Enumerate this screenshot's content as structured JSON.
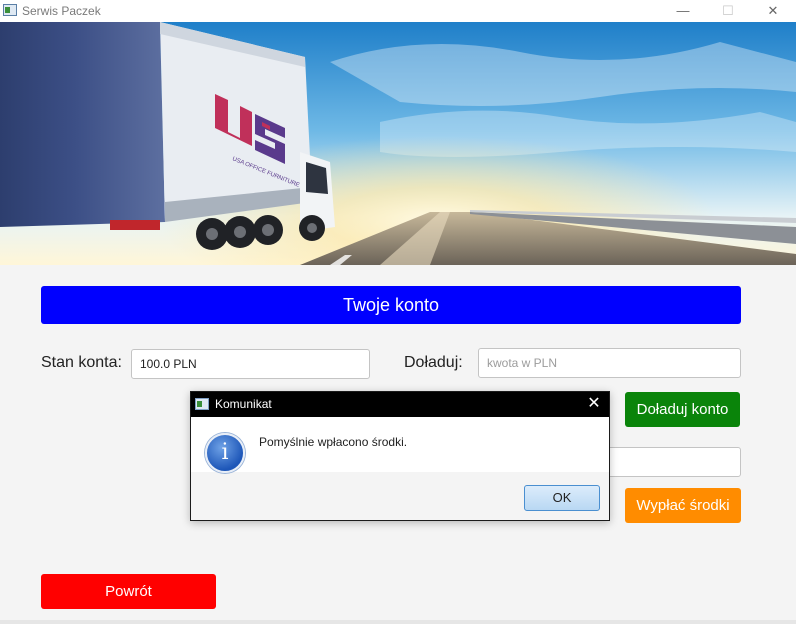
{
  "window": {
    "title": "Serwis Paczek",
    "minimize": "—",
    "maximize": "☐",
    "close": "✕"
  },
  "banner": {
    "logo_text": "USA",
    "logo_subtitle": "USA OFFICE FURNITURE"
  },
  "account": {
    "header": "Twoje konto",
    "balance_label": "Stan konta:",
    "balance_value": "100.0 PLN",
    "topup_label": "Doładuj:",
    "topup_placeholder": "kwota w PLN",
    "topup_button": "Doładuj konto",
    "withdraw_button": "Wypłać środki",
    "back_button": "Powrót"
  },
  "dialog": {
    "title": "Komunikat",
    "close": "✕",
    "icon": "info-icon",
    "icon_glyph": "i",
    "message": "Pomyślnie wpłacono środki.",
    "ok_button": "OK"
  },
  "colors": {
    "header_bar": "#0000ff",
    "topup_button": "#0a840a",
    "withdraw_button": "#ff8c00",
    "back_button": "#ff0000"
  }
}
